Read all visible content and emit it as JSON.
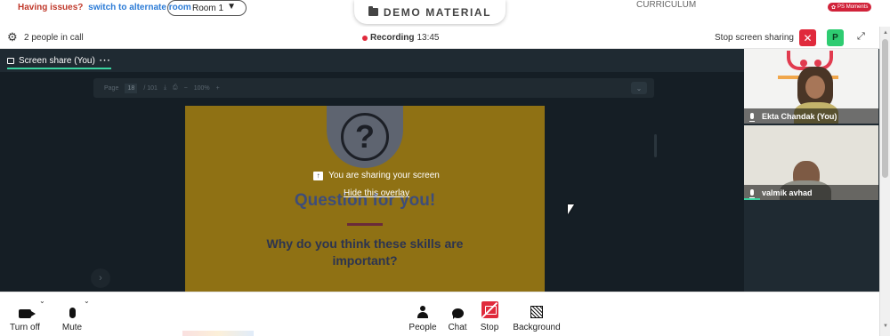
{
  "alert": {
    "issue_text": "Having issues?",
    "alternate_link": "switch to alternate room"
  },
  "room": {
    "selected": "Room 1"
  },
  "demo_tab": {
    "label": "DEMO MATERIAL",
    "icon": "folder-icon"
  },
  "curriculum": {
    "label": "CURRICULUM"
  },
  "moments": {
    "label": "PS Moments"
  },
  "call": {
    "people_count": "2 people in call",
    "recording_label": "Recording",
    "recording_time": "13:45",
    "stop_share_label": "Stop screen sharing",
    "close_label": "✕",
    "avatar_letter": "P",
    "expand_label": "⤢"
  },
  "share_tab": {
    "label": "Screen share (You)",
    "more": "···"
  },
  "pdf_toolbar": {
    "page_label": "Page",
    "page_current": "18",
    "page_total": "/ 101",
    "zoom": "100%"
  },
  "overlay": {
    "message": "You are sharing your screen",
    "hide_link": "Hide this overlay"
  },
  "slide": {
    "title": "Question for you!",
    "question": "Why do you think these skills are important?"
  },
  "participants": [
    {
      "name": "Ekta Chandak (You)"
    },
    {
      "name": "valmik avhad"
    }
  ],
  "controls": {
    "camera": "Turn off",
    "mic": "Mute",
    "people": "People",
    "chat": "Chat",
    "stop": "Stop",
    "background": "Background"
  },
  "colors": {
    "accent_green": "#3ad29f",
    "alert_red": "#e02a3c",
    "link_blue": "#2b7bd6"
  }
}
